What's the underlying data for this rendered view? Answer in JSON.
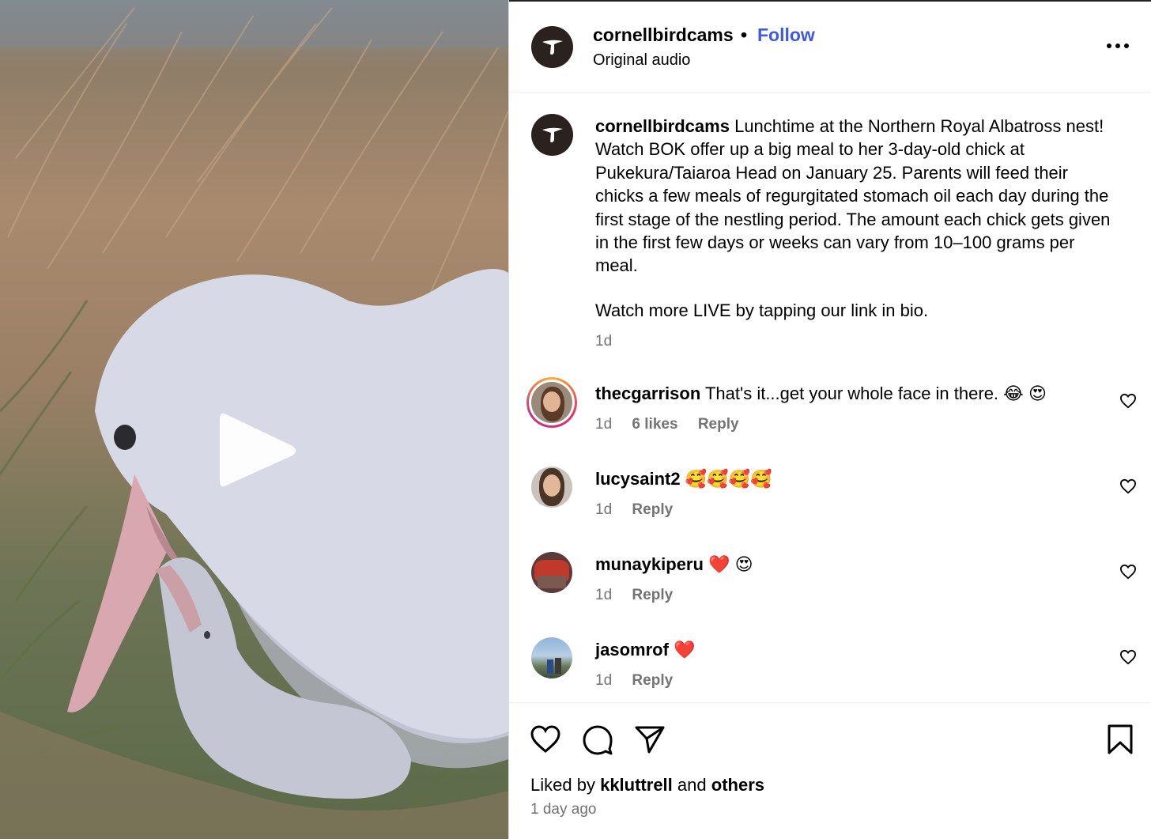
{
  "post": {
    "username": "cornellbirdcams",
    "separator": "•",
    "follow_label": "Follow",
    "audio_label": "Original audio",
    "more_icon": "more-horizontal-icon"
  },
  "media": {
    "type": "video",
    "play_icon": "play-icon"
  },
  "caption": {
    "username": "cornellbirdcams",
    "text": "Lunchtime at the Northern Royal Albatross nest! Watch BOK offer up a big meal to her 3-day-old chick at Pukekura/Taiaroa Head on January 25. Parents will feed their chicks a few meals of regurgitated stomach oil each day during the first stage of the nestling period. The amount each chick gets given in the first few days or weeks can vary from 10–100 grams per meal.",
    "text2": "Watch more LIVE by tapping our link in bio.",
    "time": "1d"
  },
  "comments": [
    {
      "username": "thecgarrison",
      "text": "That's it...get your whole face in there.",
      "emojis": [
        "😂",
        "😍"
      ],
      "time": "1d",
      "likes": "6 likes",
      "reply": "Reply"
    },
    {
      "username": "lucysaint2",
      "text": "",
      "emojis": [
        "🥰",
        "🥰",
        "🥰",
        "🥰"
      ],
      "time": "1d",
      "reply": "Reply"
    },
    {
      "username": "munaykiperu",
      "text": "",
      "emojis": [
        "❤️",
        "😍"
      ],
      "time": "1d",
      "reply": "Reply"
    },
    {
      "username": "jasomrof",
      "text": "",
      "emojis": [
        "❤️"
      ],
      "time": "1d",
      "reply": "Reply"
    }
  ],
  "actions": {
    "like_icon": "heart-icon",
    "comment_icon": "comment-icon",
    "share_icon": "send-icon",
    "save_icon": "bookmark-icon"
  },
  "likes": {
    "prefix": "Liked by",
    "user": "kkluttrell",
    "middle": "and",
    "others": "others"
  },
  "posted_ago": "1 day ago",
  "colors": {
    "follow": "#3e5be0",
    "secondary_text": "#737373",
    "brand_avatar": "#2b2220"
  }
}
